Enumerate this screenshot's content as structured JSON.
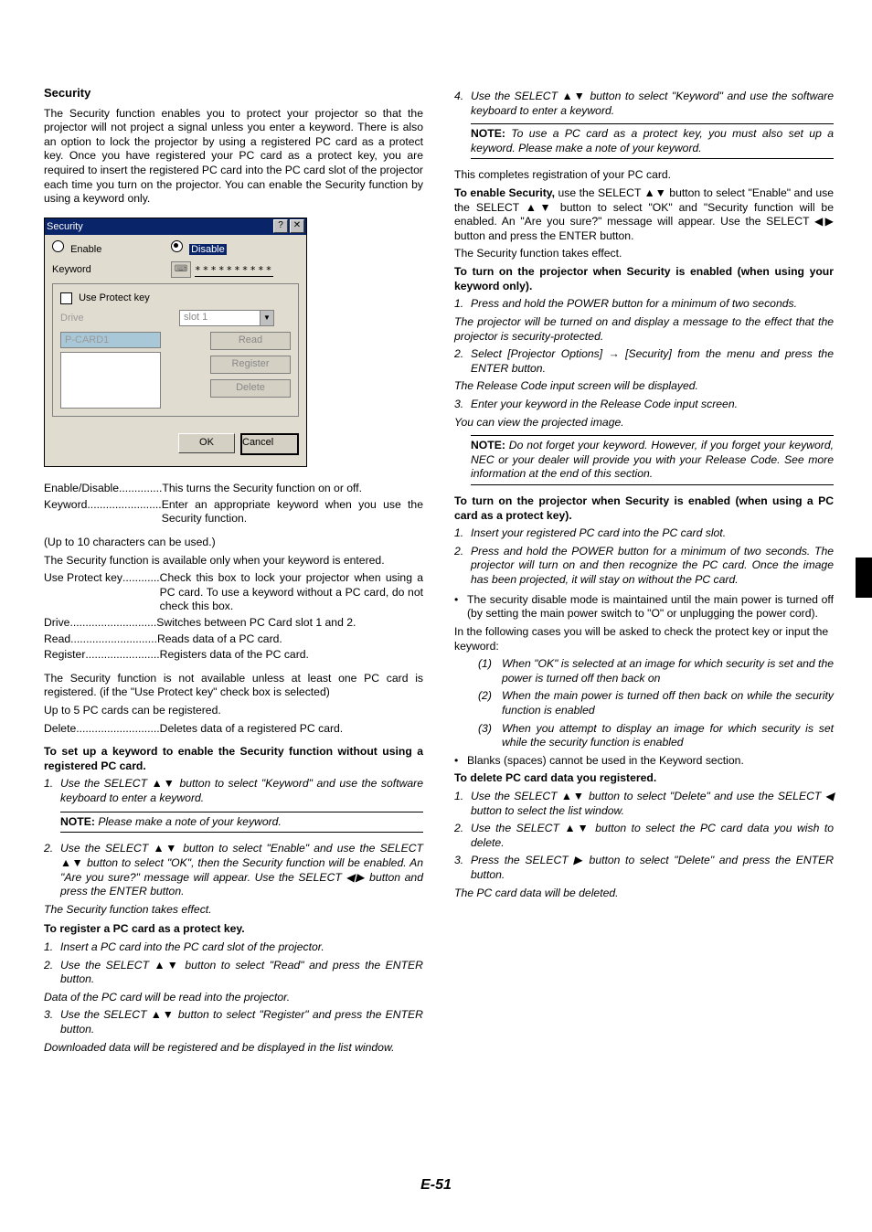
{
  "page_number": "E-51",
  "left": {
    "heading": "Security",
    "intro": "The Security function enables you to protect your projector so that the projector will not project a signal unless you enter a keyword. There is also an option to lock the projector by using a registered PC card as a protect key. Once you have registered your PC card as a protect key, you are required to insert the registered PC card into the PC card slot of the projector each time you turn on the projector. You can enable the Security function by using a keyword only.",
    "dialog": {
      "title": "Security",
      "help": "?",
      "close": "✕",
      "enable": "Enable",
      "disable": "Disable",
      "keyword_label": "Keyword",
      "keyword_kb": "⌨",
      "keyword_value": "∗∗∗∗∗∗∗∗∗∗",
      "use_protect": "Use Protect key",
      "drive": "Drive",
      "drive_value": "slot 1",
      "listhead": "P-CARD1",
      "read": "Read",
      "register": "Register",
      "delete": "Delete",
      "ok": "OK",
      "cancel": "Cancel"
    },
    "defs": [
      {
        "t": "Enable/Disable",
        "dots": " .............. ",
        "d": "This turns the Security function on or off."
      },
      {
        "t": "Keyword",
        "dots": " ........................ ",
        "d": "Enter an appropriate keyword when you use the Security function."
      }
    ],
    "defs_cont1": "(Up to 10 characters can be used.)",
    "defs_cont2": "The Security function is available only when your keyword is entered.",
    "defs2": [
      {
        "t": "Use Protect key",
        "dots": " ............ ",
        "d": "Check this box to lock your projector when using a PC card. To use a keyword without a PC card, do not check this box."
      },
      {
        "t": "Drive",
        "dots": " ............................ ",
        "d": "Switches between PC Card slot 1 and 2."
      },
      {
        "t": "Read",
        "dots": " ............................ ",
        "d": "Reads data of a PC card."
      },
      {
        "t": "Register",
        "dots": " ........................ ",
        "d": "Registers data of the PC card."
      }
    ],
    "defs2_cont1": "The Security function is not available unless at least one PC card is registered. (if the \"Use Protect key\" check box is selected)",
    "defs2_cont2": "Up to 5 PC cards can be registered.",
    "defs3": [
      {
        "t": "Delete",
        "dots": " ........................... ",
        "d": "Deletes data of a registered PC card."
      }
    ],
    "sub1": "To set up a keyword to enable the Security function without using a registered PC card.",
    "steps1": [
      {
        "n": "1",
        "b": "Use the SELECT ▲▼ button to select \"Keyword\" and use the software keyboard to enter a keyword."
      }
    ],
    "note1": "Please make a note of your keyword.",
    "steps1b": [
      {
        "n": "2",
        "b": "Use the SELECT ▲▼ button to select \"Enable\" and use the SELECT ▲▼ button to select \"OK\", then the Security function will be enabled. An \"Are you sure?\" message will appear. Use the SELECT ◀▶ button and press the ENTER button.",
        "b2": "The Security function takes effect."
      }
    ],
    "sub2": "To register a PC card as a protect key.",
    "steps2": [
      {
        "n": "1",
        "b": "Insert a PC card into the PC card slot of the projector."
      },
      {
        "n": "2",
        "b": "Use the SELECT ▲▼ button to select \"Read\" and press the ENTER button.",
        "b2": "Data of the PC card will be read into the projector."
      },
      {
        "n": "3",
        "b": "Use the SELECT ▲▼ button to select \"Register\" and press the ENTER button.",
        "b2": "Downloaded data will be registered and be displayed in the list window."
      }
    ]
  },
  "right": {
    "steps_top": [
      {
        "n": "4",
        "b": "Use the SELECT ▲▼ button to select \"Keyword\" and use the software keyboard to enter a keyword."
      }
    ],
    "note_top": "To use a PC card as a protect key, you must also set up a keyword. Please make a note of your keyword.",
    "after_note": "This completes registration of your PC card.",
    "enable_para": " use the SELECT ▲▼ button to select \"Enable\" and use the SELECT ▲▼ button to select \"OK\" and \"Security function will be enabled. An \"Are you sure?\" message will appear. Use the SELECT ◀▶ button and press the ENTER button.",
    "enable_bold": "To enable Security,",
    "enable_tail": "The Security function takes effect.",
    "sub3": "To turn on the projector when Security is enabled (when using your keyword only).",
    "steps3": [
      {
        "n": "1",
        "b": "Press and hold the POWER button for a minimum of two seconds.",
        "b2": "The projector will be turned on and display a message to the effect that the projector is security-protected."
      },
      {
        "n": "2",
        "b": "Select [Projector Options] → [Security] from the menu and press the ENTER button.",
        "b2": "The Release Code input screen will be displayed."
      },
      {
        "n": "3",
        "b": "Enter your keyword in the Release Code input screen.",
        "b2": "You can view the projected image."
      }
    ],
    "note2": "Do not forget your keyword. However, if you forget your keyword, NEC or your dealer will provide you with your Release Code. See more information at the end of this section.",
    "sub4": "To turn on the projector when Security is enabled (when using a PC card as a protect key).",
    "steps4": [
      {
        "n": "1",
        "b": "Insert your registered PC card into the PC card slot."
      },
      {
        "n": "2",
        "b": "Press and hold the POWER button for a minimum of two seconds. The projector will turn on and then recognize the PC card. Once the image has been projected, it will stay on without the PC card."
      }
    ],
    "bullets1": [
      "The security disable mode is maintained until the main power is turned off (by setting the main power switch to \"O\" or unplugging the power cord)."
    ],
    "bullets1_cont": "In the following cases you will be asked to check the protect key or input the keyword:",
    "sublist": [
      {
        "n": "(1)",
        "b": "When \"OK\" is selected at an image for which security is set and the power is turned off then back on"
      },
      {
        "n": "(2)",
        "b": "When the main power is turned off then back on while the security function is enabled"
      },
      {
        "n": "(3)",
        "b": "When you attempt to display an image for which security is set while the security function is enabled"
      }
    ],
    "bullets2": [
      "Blanks (spaces) cannot be used in the Keyword section."
    ],
    "sub5": "To delete PC card data you registered.",
    "steps5": [
      {
        "n": "1",
        "b": "Use the SELECT ▲▼ button to select \"Delete\" and use the SELECT ◀ button to select the list window."
      },
      {
        "n": "2",
        "b": "Use the SELECT ▲▼ button to select the PC card data you wish to delete."
      },
      {
        "n": "3",
        "b": "Press the SELECT ▶ button to select \"Delete\" and press the ENTER button.",
        "b2": "The PC card data will be deleted."
      }
    ]
  }
}
